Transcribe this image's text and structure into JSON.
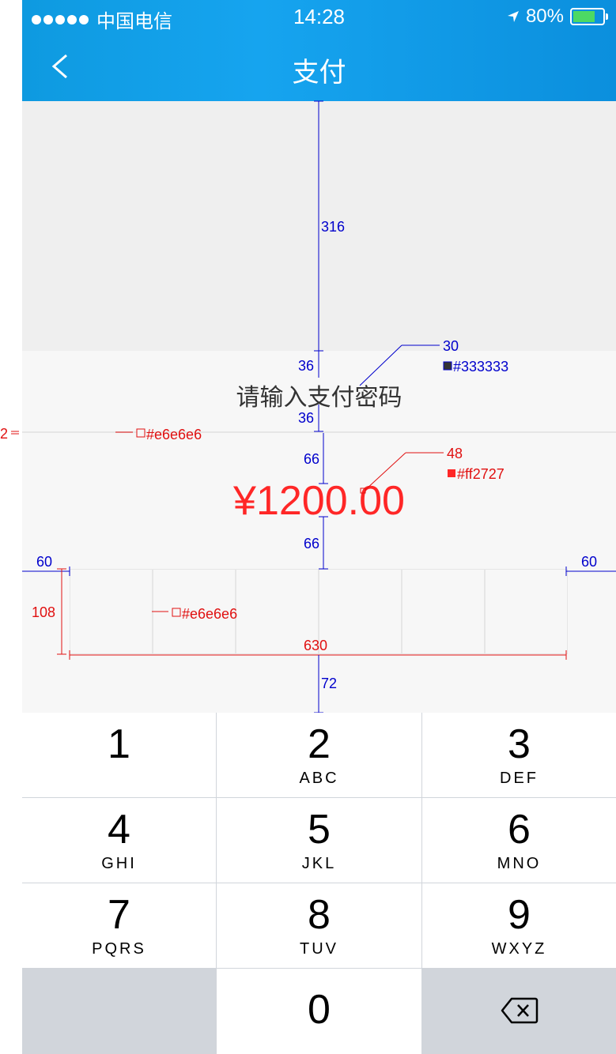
{
  "status_bar": {
    "carrier": "中国电信",
    "time": "14:28",
    "battery": "80%",
    "battery_level": 0.8
  },
  "navbar": {
    "title": "支付"
  },
  "payment": {
    "prompt": "请输入支付密码",
    "amount": "¥1200.00",
    "password_boxes": 6
  },
  "annotations": {
    "top_space": "316",
    "prompt_gap_top": "36",
    "prompt_gap_bottom": "36",
    "prompt_font_size": "30",
    "prompt_color": "#333333",
    "divider_height": "2",
    "divider_color": "#e6e6e6",
    "amount_gap_top": "66",
    "amount_gap_bottom": "66",
    "amount_font_size": "48",
    "amount_color": "#ff2727",
    "box_margin_left": "60",
    "box_margin_right": "60",
    "box_height": "108",
    "box_border_color": "#e6e6e6",
    "box_width_total": "630",
    "bottom_gap": "72"
  },
  "keypad": {
    "keys": [
      {
        "digit": "1",
        "letters": ""
      },
      {
        "digit": "2",
        "letters": "ABC"
      },
      {
        "digit": "3",
        "letters": "DEF"
      },
      {
        "digit": "4",
        "letters": "GHI"
      },
      {
        "digit": "5",
        "letters": "JKL"
      },
      {
        "digit": "6",
        "letters": "MNO"
      },
      {
        "digit": "7",
        "letters": "PQRS"
      },
      {
        "digit": "8",
        "letters": "TUV"
      },
      {
        "digit": "9",
        "letters": "WXYZ"
      },
      {
        "digit": "0",
        "letters": ""
      }
    ]
  },
  "colors": {
    "header": "#12a0ea",
    "blue_annotation": "#0000cc",
    "red_annotation": "#e01010"
  }
}
